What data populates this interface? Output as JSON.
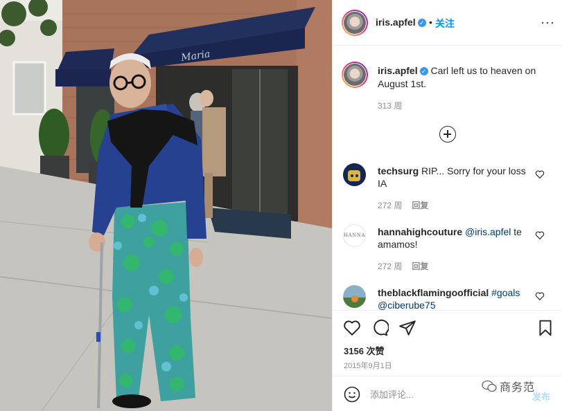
{
  "header": {
    "username": "iris.apfel",
    "separator": "•",
    "follow_label": "关注",
    "more_label": "···"
  },
  "photo": {
    "awning_text": "Maria"
  },
  "caption": {
    "username": "iris.apfel",
    "text": "Carl left us to heaven on August 1st.",
    "time": "313 周"
  },
  "comments": [
    {
      "username": "techsurg",
      "text": "RIP... Sorry for your loss IA",
      "time": "272 周",
      "reply_label": "回复"
    },
    {
      "username": "hannahighcouture",
      "mention": "@iris.apfel",
      "text": "te amamos!",
      "time": "272 周",
      "reply_label": "回复",
      "avatar_text": "HANNA"
    },
    {
      "username": "theblackflamingoofficial",
      "hashtag": "#goals",
      "mention": "@ciberube75"
    }
  ],
  "actions": {
    "likes": "3156 次赞",
    "date": "2015年9月1日"
  },
  "comment_box": {
    "placeholder": "添加评论...",
    "post_label": "发布"
  },
  "watermark": {
    "text": "商务范"
  },
  "colors": {
    "accent_blue": "#0095f6",
    "verified_blue": "#3897f0",
    "mention_blue": "#00376b",
    "muted_gray": "#8e8e8e",
    "post_disabled": "#b2dffc"
  }
}
